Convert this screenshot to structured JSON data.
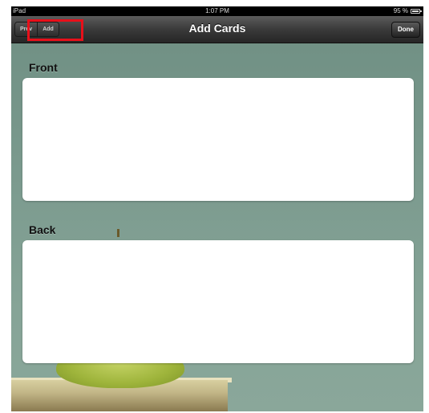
{
  "status_bar": {
    "device": "iPad",
    "time": "1:07 PM",
    "battery": "95 %"
  },
  "nav": {
    "title": "Add Cards",
    "segment_prev": "Prev",
    "segment_add": "Add",
    "done": "Done"
  },
  "form": {
    "front_label": "Front",
    "back_label": "Back",
    "front_value": "",
    "back_value": ""
  },
  "colors": {
    "highlight": "#e8101a",
    "background": "#7c9b8f"
  }
}
